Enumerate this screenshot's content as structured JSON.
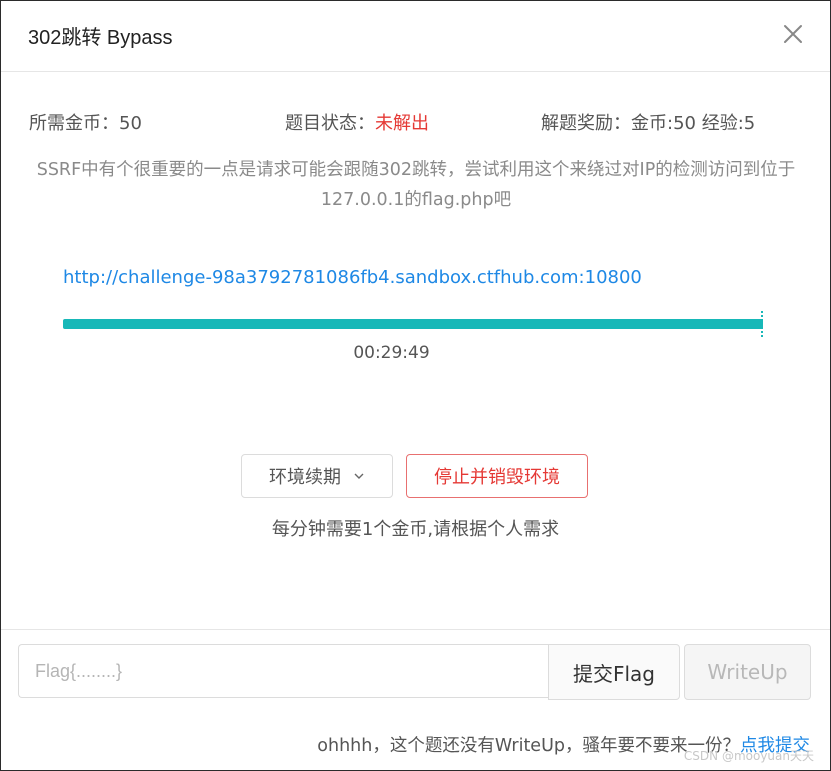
{
  "dialog": {
    "title": "302跳转 Bypass"
  },
  "info": {
    "coins_required": "所需金币：50",
    "status_label": "题目状态：",
    "status_value": "未解出",
    "reward": "解题奖励：金币:50 经验:5"
  },
  "description": "SSRF中有个很重要的一点是请求可能会跟随302跳转，尝试利用这个来绕过对IP的检测访问到位于127.0.0.1的flag.php吧",
  "environment": {
    "url": "http://challenge-98a3792781086fb4.sandbox.ctfhub.com:10800",
    "remaining_fraction": 1.0,
    "timer": "00:29:49"
  },
  "actions": {
    "renew_label": "环境续期",
    "stop_label": "停止并销毁环境",
    "cost_note": "每分钟需要1个金币,请根据个人需求"
  },
  "footer": {
    "flag_placeholder": "Flag{........}",
    "submit_label": "提交Flag",
    "writeup_label": "WriteUp",
    "note_text": "ohhhh，这个题还没有WriteUp，骚年要不要来一份？",
    "note_link": "点我提交",
    "watermark": "CSDN @mooyuan天天"
  },
  "colors": {
    "progress": "#17b8b8",
    "link": "#1e88e5",
    "danger": "#e53935"
  },
  "icons": [
    "close-icon",
    "chevron-down-icon"
  ]
}
